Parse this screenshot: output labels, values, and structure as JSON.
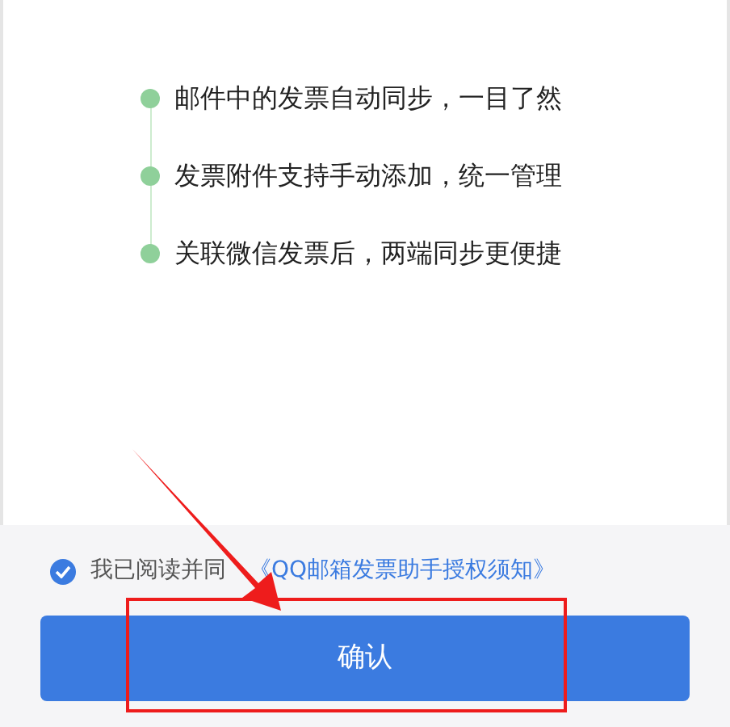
{
  "features": [
    {
      "text": "邮件中的发票自动同步，一目了然"
    },
    {
      "text": "发票附件支持手动添加，统一管理"
    },
    {
      "text": "关联微信发票后，两端同步更便捷"
    }
  ],
  "agreement": {
    "checked": true,
    "text": "我已阅读并同",
    "link": "《QQ邮箱发票助手授权须知》"
  },
  "confirm_button": {
    "label": "确认"
  }
}
